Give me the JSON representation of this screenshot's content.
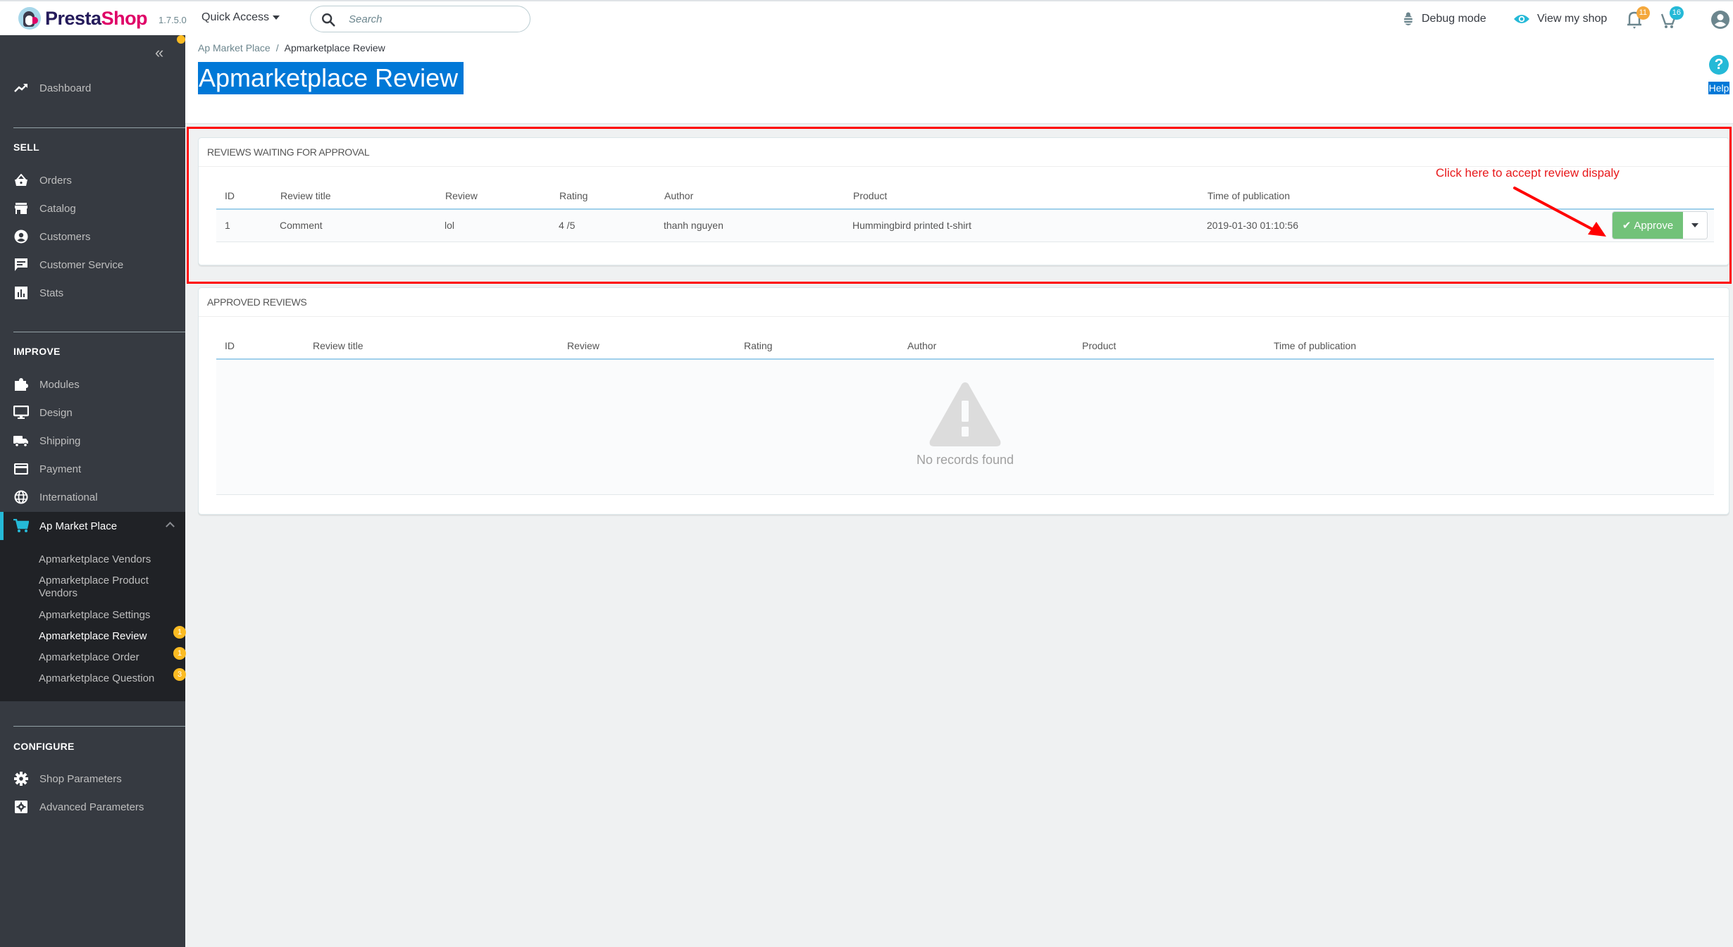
{
  "topbar": {
    "brand_part1": "Presta",
    "brand_part2": "Shop",
    "version": "1.7.5.0",
    "quick_access_label": "Quick Access",
    "search_placeholder": "Search",
    "debug_mode_label": "Debug mode",
    "view_shop_label": "View my shop",
    "notifications_count": "11",
    "orders_count": "16"
  },
  "sidebar": {
    "collapse_icon": "«",
    "dashboard": {
      "label": "Dashboard",
      "icon": "trending-up-icon"
    },
    "sections": [
      {
        "title": "SELL",
        "items": [
          {
            "label": "Orders",
            "icon": "basket-icon"
          },
          {
            "label": "Catalog",
            "icon": "store-icon"
          },
          {
            "label": "Customers",
            "icon": "account-circle-icon"
          },
          {
            "label": "Customer Service",
            "icon": "chat-icon"
          },
          {
            "label": "Stats",
            "icon": "bar-chart-icon"
          }
        ]
      },
      {
        "title": "IMPROVE",
        "items": [
          {
            "label": "Modules",
            "icon": "puzzle-icon"
          },
          {
            "label": "Design",
            "icon": "desktop-icon"
          },
          {
            "label": "Shipping",
            "icon": "truck-icon"
          },
          {
            "label": "Payment",
            "icon": "credit-card-icon"
          },
          {
            "label": "International",
            "icon": "globe-icon"
          },
          {
            "label": "Ap Market Place",
            "icon": "cart-icon",
            "active": true
          }
        ]
      },
      {
        "title": "CONFIGURE",
        "items": [
          {
            "label": "Shop Parameters",
            "icon": "gear-icon"
          },
          {
            "label": "Advanced Parameters",
            "icon": "settings-box-icon"
          }
        ]
      }
    ],
    "submenu": [
      {
        "label": "Apmarketplace Vendors"
      },
      {
        "label": "Apmarketplace Product Vendors"
      },
      {
        "label": "Apmarketplace Settings"
      },
      {
        "label": "Apmarketplace Review",
        "current": true,
        "badge": "1"
      },
      {
        "label": "Apmarketplace Order",
        "badge": "1"
      },
      {
        "label": "Apmarketplace Question",
        "badge": "3"
      }
    ]
  },
  "header": {
    "breadcrumb_parent": "Ap Market Place",
    "breadcrumb_separator": "/",
    "breadcrumb_current": "Apmarketplace Review",
    "title": "Apmarketplace Review",
    "help_icon": "?",
    "help_label": "Help"
  },
  "pending_panel": {
    "heading": "Reviews waiting for approval",
    "columns": [
      "ID",
      "Review title",
      "Review",
      "Rating",
      "Author",
      "Product",
      "Time of publication"
    ],
    "rows": [
      {
        "id": "1",
        "title": "Comment",
        "review": "lol",
        "rating": "4 /5",
        "author": "thanh nguyen",
        "product": "Hummingbird printed t-shirt",
        "time": "2019-01-30 01:10:56"
      }
    ],
    "approve_label": "Approve",
    "approve_icon": "✔"
  },
  "approved_panel": {
    "heading": "Approved reviews",
    "columns": [
      "ID",
      "Review title",
      "Review",
      "Rating",
      "Author",
      "Product",
      "Time of publication"
    ],
    "empty_message": "No records found"
  },
  "annotation": {
    "text": "Click here to accept review dispaly",
    "color": "#e8191b"
  },
  "colors": {
    "accent": "#25b9d7",
    "sidebar_bg": "#363a41",
    "approve_green": "#72c279",
    "badge_yellow": "#fbbb22",
    "selection_blue": "#0078d7",
    "highlight_red": "#ff0000"
  }
}
